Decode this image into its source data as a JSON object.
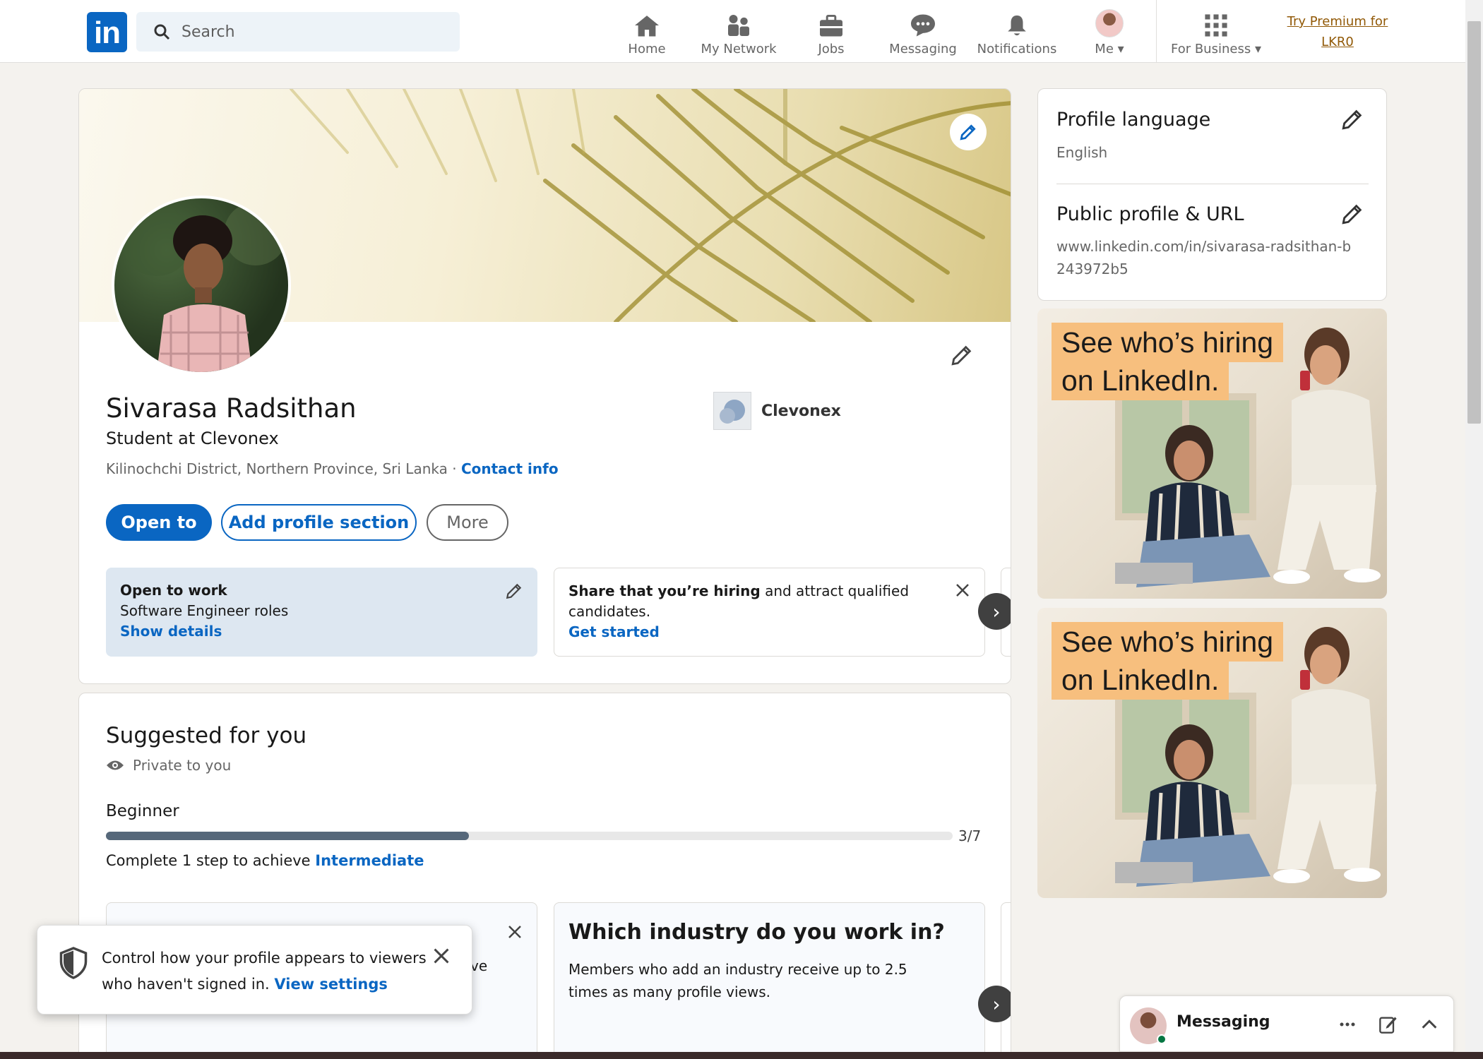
{
  "nav": {
    "logo": "in",
    "search_placeholder": "Search",
    "items": [
      {
        "label": "Home",
        "icon": "home-icon"
      },
      {
        "label": "My Network",
        "icon": "network-icon"
      },
      {
        "label": "Jobs",
        "icon": "briefcase-icon"
      },
      {
        "label": "Messaging",
        "icon": "chat-icon"
      },
      {
        "label": "Notifications",
        "icon": "bell-icon"
      },
      {
        "label": "Me",
        "icon": "avatar"
      },
      {
        "label": "For Business",
        "icon": "grid-icon"
      }
    ],
    "premium": "Try Premium for LKR0"
  },
  "profile": {
    "name": "Sivarasa Radsithan",
    "headline": "Student at Clevonex",
    "location": "Kilinochchi District, Northern Province, Sri Lanka · ",
    "contact_info": "Contact info",
    "company": "Clevonex",
    "buttons": {
      "open_to": "Open to",
      "add_section": "Add profile section",
      "more": "More"
    },
    "open_to_work": {
      "title": "Open to work",
      "roles": "Software Engineer roles",
      "link": "Show details"
    },
    "hiring": {
      "bold": "Share that you’re hiring",
      "rest": " and attract qualified candidates.",
      "link": "Get started"
    }
  },
  "suggested": {
    "title": "Suggested for you",
    "private": "Private to you",
    "level": "Beginner",
    "progress": {
      "current": 3,
      "total": 7,
      "label": "3/7"
    },
    "step_text": "Complete 1 step to achieve ",
    "step_link": "Intermediate",
    "industry_title": "Which industry do you work in?",
    "industry_desc": "Members who add an industry receive up to 2.5 times as many profile views."
  },
  "sidebar": {
    "language_title": "Profile language",
    "language_value": "English",
    "url_title": "Public profile & URL",
    "url_value": "www.linkedin.com/in/sivarasa-radsithan-b243972b5",
    "ad_line1": "See who’s hiring",
    "ad_line2": "on LinkedIn."
  },
  "toast": {
    "message": "Control how your profile appears to viewers who haven't signed in. ",
    "link": "View settings",
    "behind_fragment": "ve"
  },
  "messaging": {
    "label": "Messaging"
  },
  "colors": {
    "brand": "#0a66c2",
    "premium": "#915907",
    "progress": "#56687a"
  }
}
